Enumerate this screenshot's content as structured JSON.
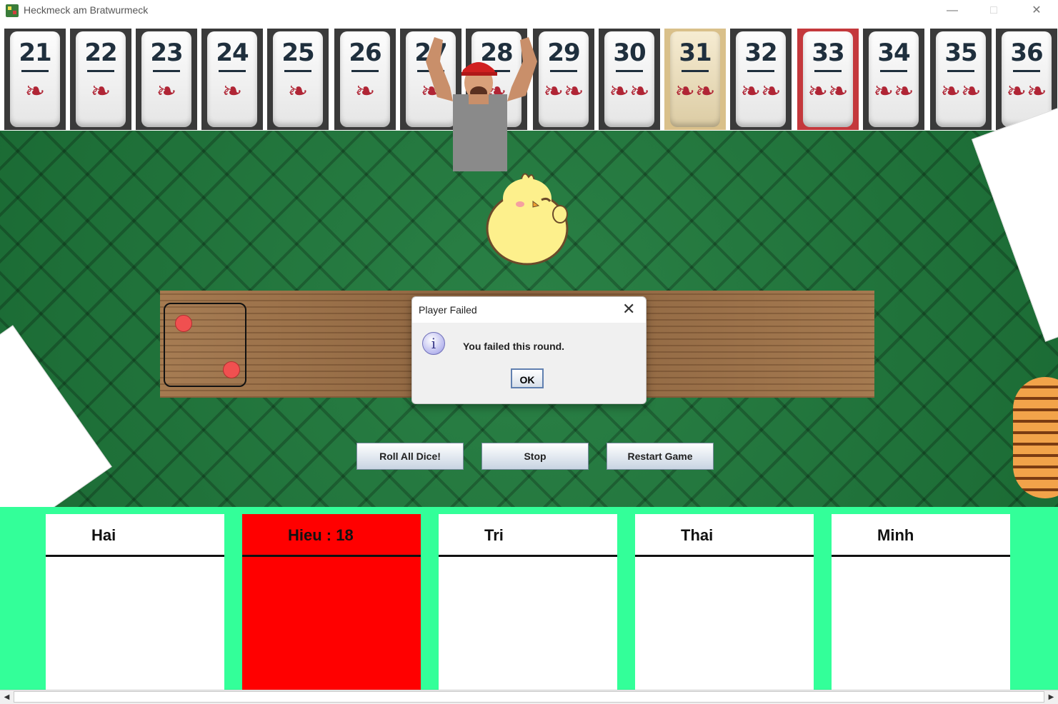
{
  "window": {
    "title": "Heckmeck am Bratwurmeck",
    "minimize": "—",
    "maximize": "□",
    "close": "✕"
  },
  "tiles": [
    {
      "number": "21",
      "worm": "❧"
    },
    {
      "number": "22",
      "worm": "❧"
    },
    {
      "number": "23",
      "worm": "❧"
    },
    {
      "number": "24",
      "worm": "❧"
    },
    {
      "number": "25",
      "worm": "❧"
    },
    {
      "number": "26",
      "worm": "❧"
    },
    {
      "number": "27",
      "worm": "❧"
    },
    {
      "number": "28",
      "worm": "❧"
    },
    {
      "number": "29",
      "worm": "❧❧"
    },
    {
      "number": "30",
      "worm": "❧❧"
    },
    {
      "number": "31",
      "worm": "❧❧"
    },
    {
      "number": "32",
      "worm": "❧❧"
    },
    {
      "number": "33",
      "worm": "❧❧"
    },
    {
      "number": "34",
      "worm": "❧❧"
    },
    {
      "number": "35",
      "worm": "❧❧"
    },
    {
      "number": "36",
      "worm": "❧❧"
    }
  ],
  "controls": {
    "roll": "Roll All Dice!",
    "stop": "Stop",
    "restart": "Restart Game"
  },
  "dialog": {
    "title": "Player Failed",
    "close": "✕",
    "icon": "i",
    "message": "You failed this round.",
    "ok": "OK"
  },
  "players": [
    {
      "name": "Hai"
    },
    {
      "name": "Hieu : 18"
    },
    {
      "name": "Tri"
    },
    {
      "name": "Thai"
    },
    {
      "name": "Minh"
    }
  ],
  "scrollbar": {
    "left": "◀",
    "right": "▶"
  }
}
